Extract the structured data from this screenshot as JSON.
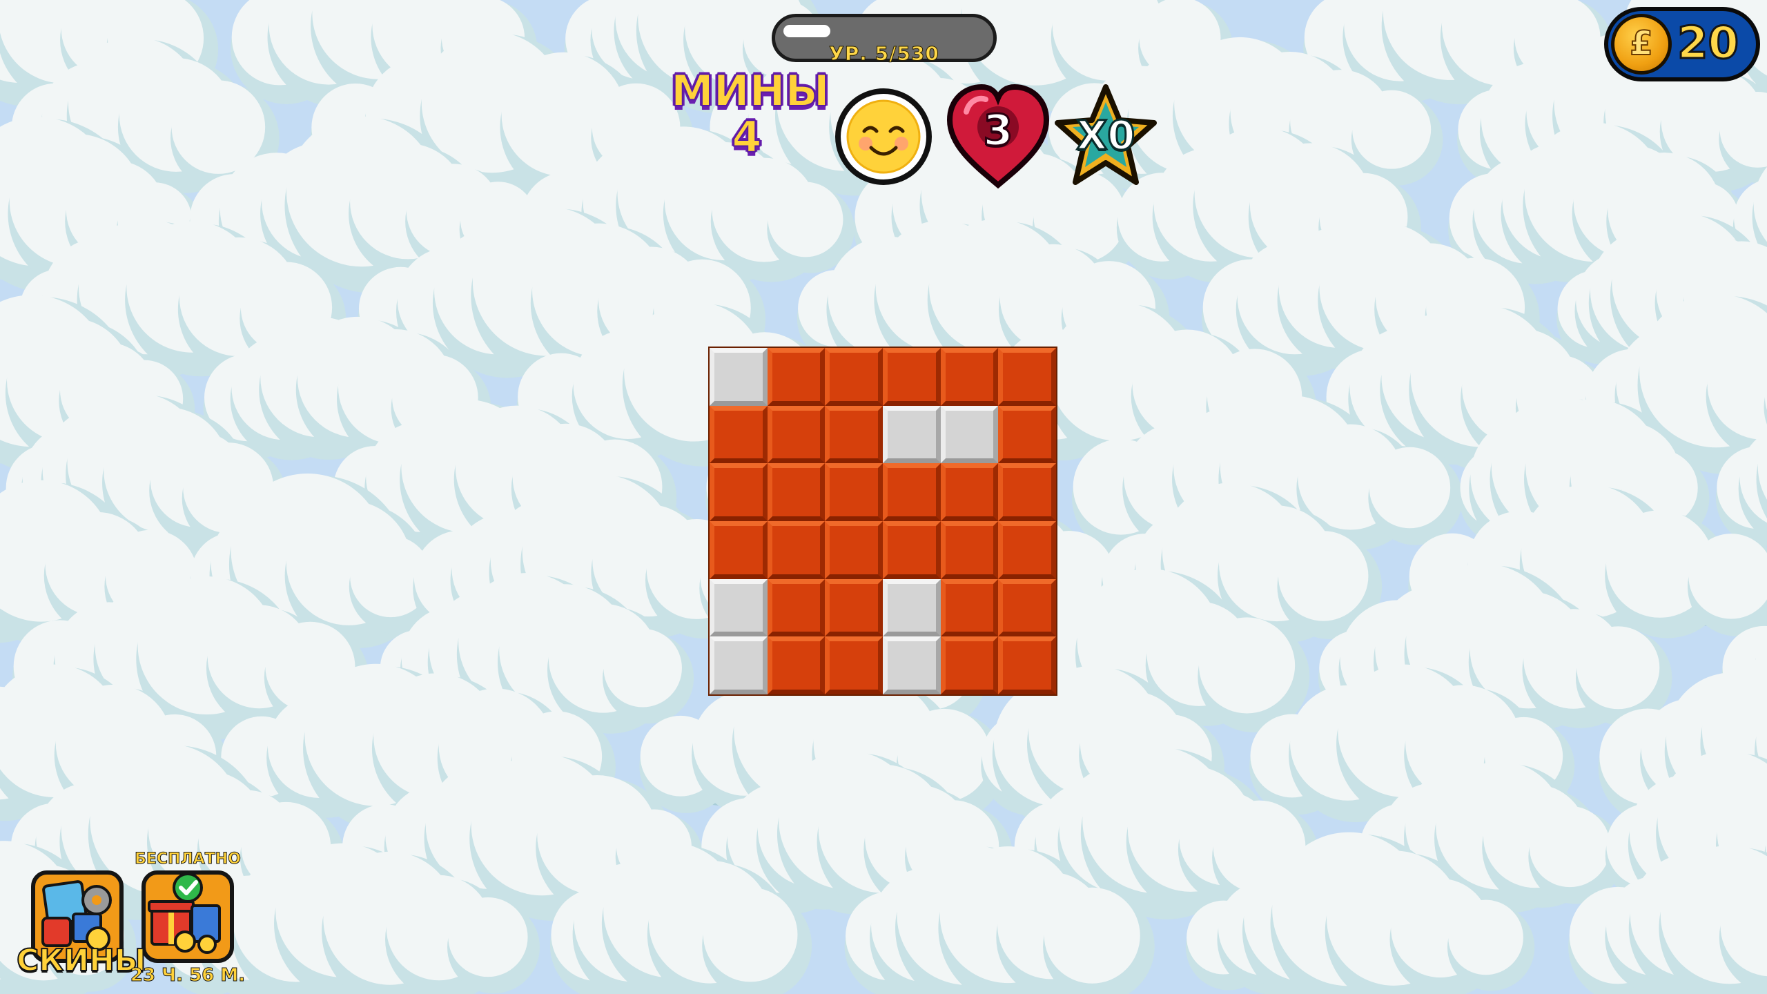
{
  "hud": {
    "level_label": "УР. 5/530",
    "level_progress": 0.06,
    "mines_label": "МИНЫ",
    "mines_count": "4",
    "lives": "3",
    "multiplier": "X0",
    "coins": "20",
    "coin_symbol": "£"
  },
  "board": {
    "rows": 6,
    "cols": 6,
    "cells": [
      [
        "open",
        "closed",
        "closed",
        "closed",
        "closed",
        "closed"
      ],
      [
        "closed",
        "closed",
        "closed",
        "open",
        "open",
        "closed"
      ],
      [
        "closed",
        "closed",
        "closed",
        "closed",
        "closed",
        "closed"
      ],
      [
        "closed",
        "closed",
        "closed",
        "closed",
        "closed",
        "closed"
      ],
      [
        "open",
        "closed",
        "closed",
        "open",
        "closed",
        "closed"
      ],
      [
        "open",
        "closed",
        "closed",
        "open",
        "closed",
        "closed"
      ]
    ]
  },
  "buttons": {
    "skins_label": "СКИНЫ",
    "gift_badge": "БЕСПЛАТНО",
    "gift_timer": "23 Ч. 56 М."
  },
  "icons": {
    "smiley": "smiley-face-icon",
    "heart": "heart-icon",
    "star": "star-icon",
    "coin": "coin-icon",
    "skins": "skins-icon",
    "gift": "gift-icon"
  },
  "colors": {
    "closed_tile": "#d6400c",
    "open_tile": "#d4d4d4",
    "mines_text": "#ffd23a",
    "coin_bg": "#0b4aa8"
  }
}
